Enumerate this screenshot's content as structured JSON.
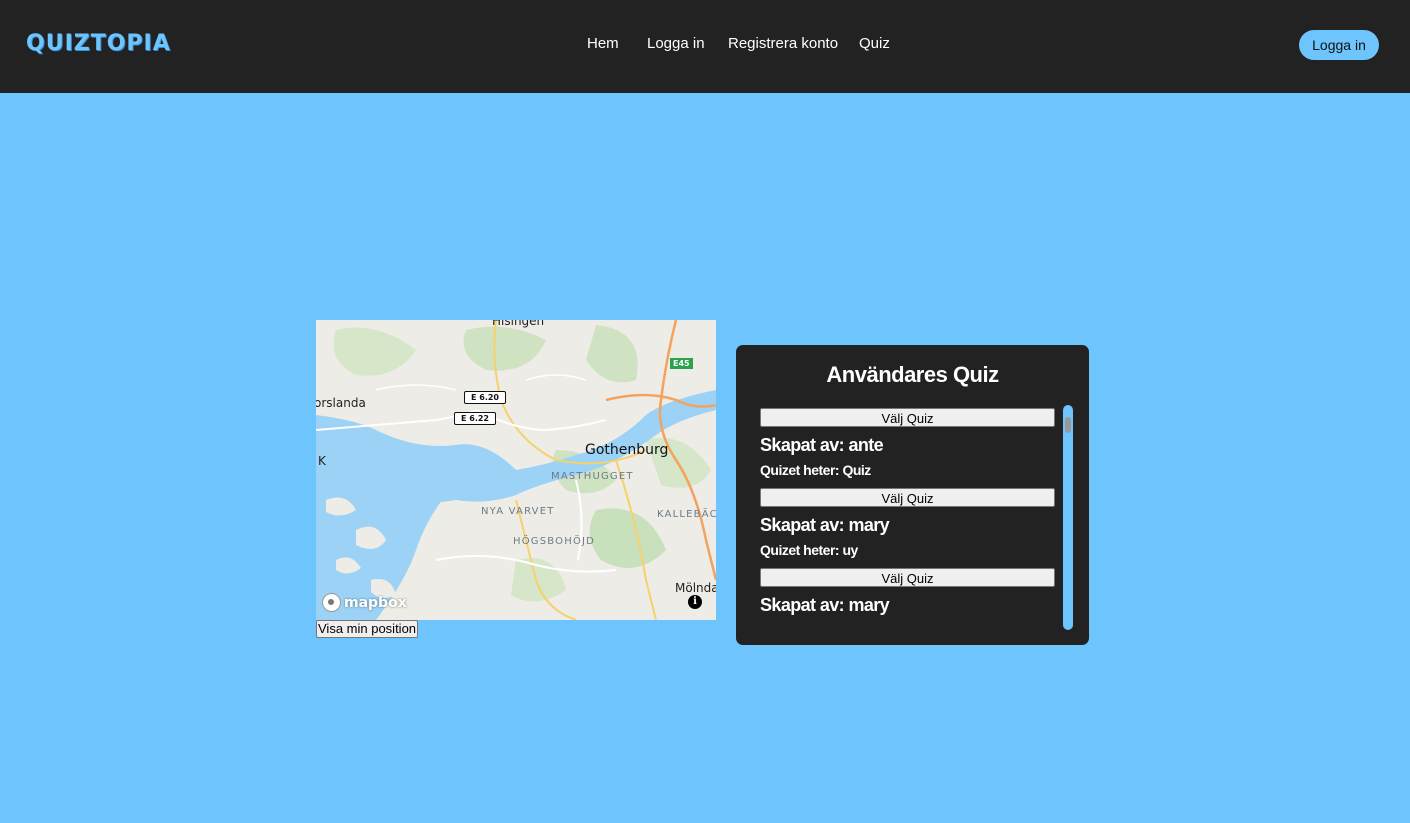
{
  "brand": {
    "logo": "QUIZTOPIA"
  },
  "nav": {
    "links": [
      "Hem",
      "Logga in",
      "Registrera konto",
      "Quiz"
    ],
    "login_button": "Logga in"
  },
  "map": {
    "labels": {
      "city": "Gothenburg",
      "district_1": "MASTHUGGET",
      "district_2": "NYA VARVET",
      "district_3": "HÖGSBOHÖJD",
      "district_4": "KALLEBÄC",
      "place_1": "orslanda",
      "place_2": "Mölnda",
      "place_3": "Hisingen",
      "place_4": "K"
    },
    "road_shields": [
      "E 6.20",
      "E 6.22",
      "E45"
    ],
    "attribution": "mapbox",
    "info_icon": "info-icon",
    "position_button": "Visa min position"
  },
  "quiz_panel": {
    "title": "Användares Quiz",
    "items": [
      {
        "button": "Välj Quiz",
        "creator": "Skapat av: ante",
        "name": "Quizet heter: Quiz"
      },
      {
        "button": "Välj Quiz",
        "creator": "Skapat av: mary",
        "name": "Quizet heter: uy"
      },
      {
        "button": "Välj Quiz",
        "creator": "Skapat av: mary",
        "name": ""
      }
    ]
  },
  "colors": {
    "background": "#6ec4fd",
    "navbar": "#222222",
    "panel": "#222222",
    "accent": "#6ec4fd"
  }
}
